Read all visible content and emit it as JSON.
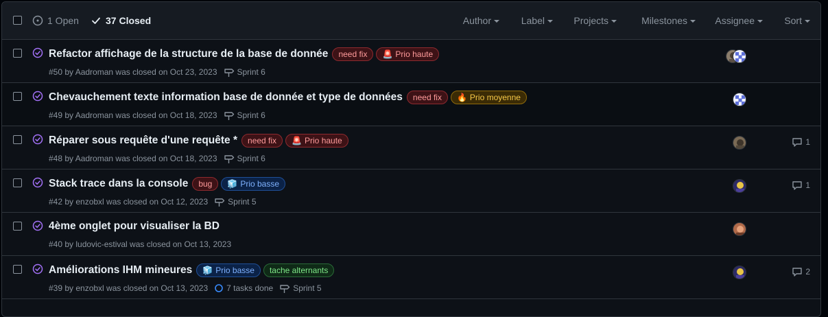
{
  "header": {
    "open_count": "1 Open",
    "closed_count": "37 Closed",
    "filters": [
      "Author",
      "Label",
      "Projects",
      "Milestones",
      "Assignee",
      "Sort"
    ]
  },
  "colors": {
    "closed_status": "#a371f7",
    "background": "#0d1117",
    "header_bg": "#161b22",
    "border": "#30363d",
    "muted": "#8b949e"
  },
  "issues": [
    {
      "title": "Refactor affichage de la structure de la base de donnée",
      "labels": [
        {
          "text": "need fix",
          "kind": "needfix"
        },
        {
          "text": "Prio haute",
          "kind": "haute",
          "icon": "beacon-icon"
        }
      ],
      "meta": "#50 by Aadroman was closed on Oct 23, 2023",
      "milestone": "Sprint 6",
      "comments": ""
    },
    {
      "title": "Chevauchement texte information base de donnée et type de données",
      "labels": [
        {
          "text": "need fix",
          "kind": "needfix"
        },
        {
          "text": "Prio moyenne",
          "kind": "moyenne",
          "icon": "fire-icon"
        }
      ],
      "meta": "#49 by Aadroman was closed on Oct 18, 2023",
      "milestone": "Sprint 6",
      "comments": ""
    },
    {
      "title": "Réparer sous requête d'une requête *",
      "labels": [
        {
          "text": "need fix",
          "kind": "needfix"
        },
        {
          "text": "Prio haute",
          "kind": "haute",
          "icon": "beacon-icon"
        }
      ],
      "meta": "#48 by Aadroman was closed on Oct 18, 2023",
      "milestone": "Sprint 6",
      "comments": "1"
    },
    {
      "title": "Stack trace dans la console",
      "labels": [
        {
          "text": "bug",
          "kind": "bug"
        },
        {
          "text": "Prio basse",
          "kind": "basse",
          "icon": "cube-icon"
        }
      ],
      "meta": "#42 by enzobxl was closed on Oct 12, 2023",
      "milestone": "Sprint 5",
      "comments": "1"
    },
    {
      "title": "4ème onglet pour visualiser la BD",
      "labels": [],
      "meta": "#40 by ludovic-estival was closed on Oct 13, 2023",
      "milestone": "",
      "comments": ""
    },
    {
      "title": "Améliorations IHM mineures",
      "labels": [
        {
          "text": "Prio basse",
          "kind": "basse",
          "icon": "cube-icon"
        },
        {
          "text": "tache alternants",
          "kind": "alt"
        }
      ],
      "meta": "#39 by enzobxl was closed on Oct 13, 2023",
      "tasks": "7 tasks done",
      "milestone": "Sprint 5",
      "comments": "2"
    }
  ]
}
